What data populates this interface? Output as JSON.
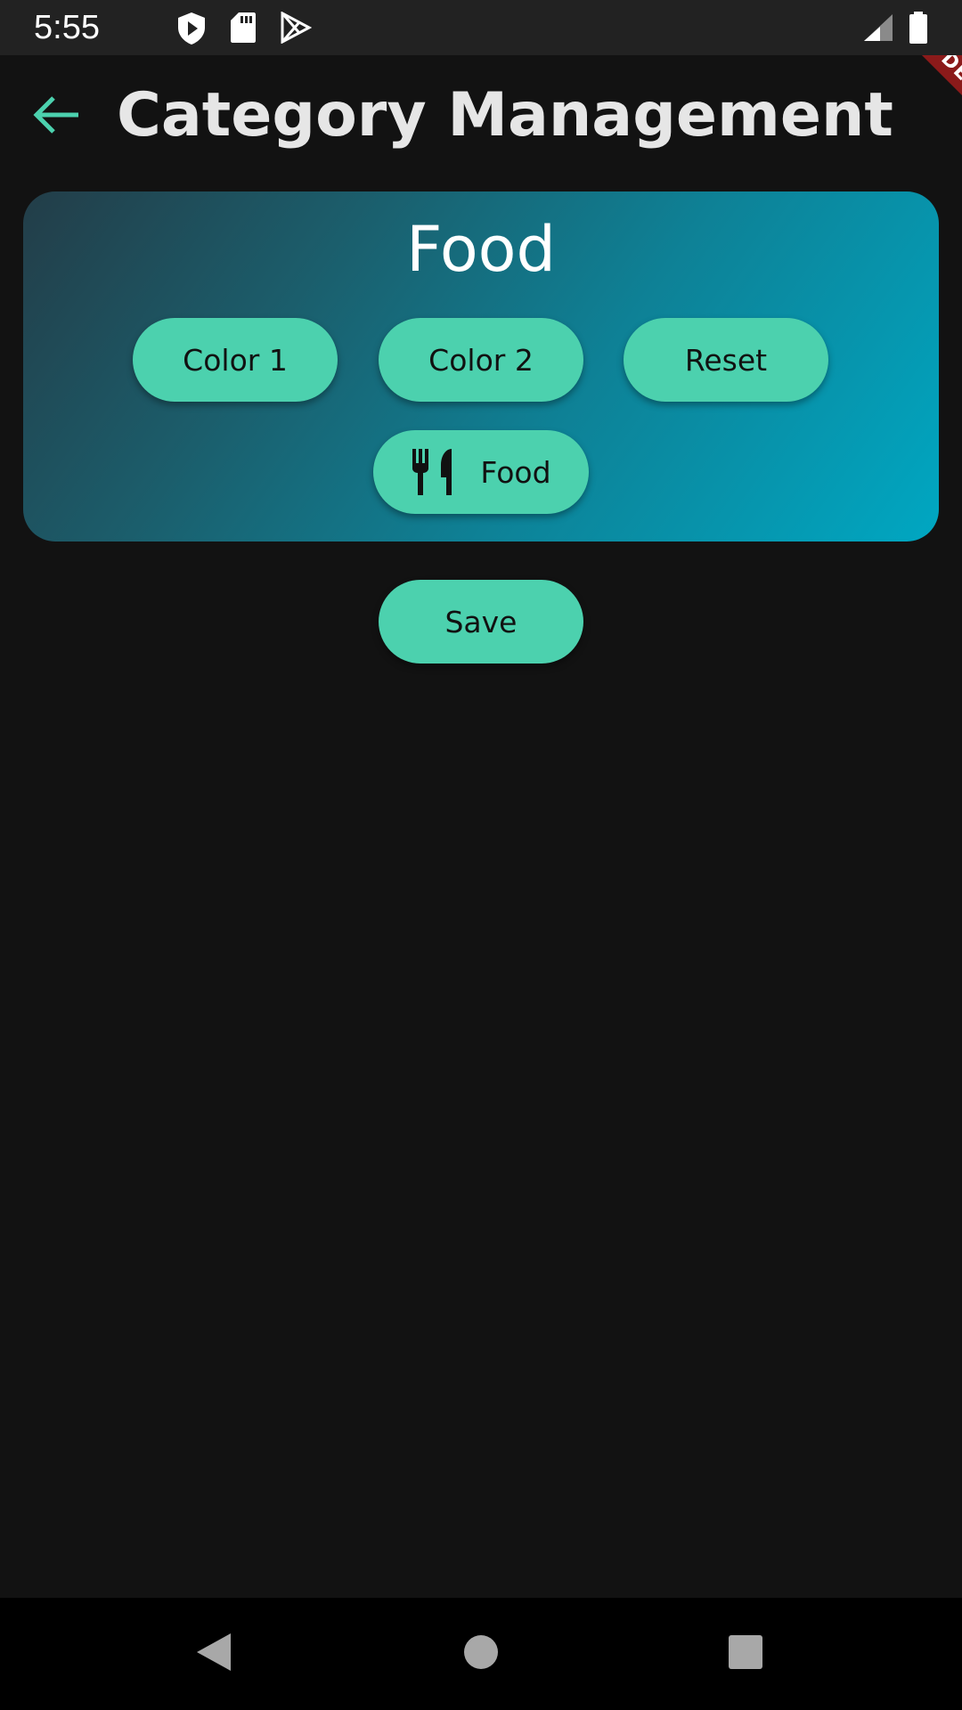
{
  "status_bar": {
    "time": "5:55",
    "icons": [
      "play-protect-icon",
      "sd-card-icon",
      "play-store-icon",
      "signal-icon",
      "battery-icon"
    ]
  },
  "app_bar": {
    "back_icon": "arrow-back-icon",
    "title": "Category Management"
  },
  "debug_banner": {
    "label": "DEBUG"
  },
  "category_card": {
    "title": "Food",
    "buttons": [
      {
        "label": "Color 1"
      },
      {
        "label": "Color 2"
      },
      {
        "label": "Reset"
      }
    ],
    "icon_chip": {
      "icon": "restaurant-icon",
      "label": "Food"
    },
    "gradient_colors": [
      "#233d48",
      "#00a7c2"
    ]
  },
  "save_button": {
    "label": "Save"
  },
  "nav_bar": {
    "buttons": [
      "back-triangle-icon",
      "home-circle-icon",
      "recents-square-icon"
    ]
  },
  "colors": {
    "accent": "#4cd1ae",
    "background": "#121212",
    "title_text": "#e6e6e6"
  }
}
